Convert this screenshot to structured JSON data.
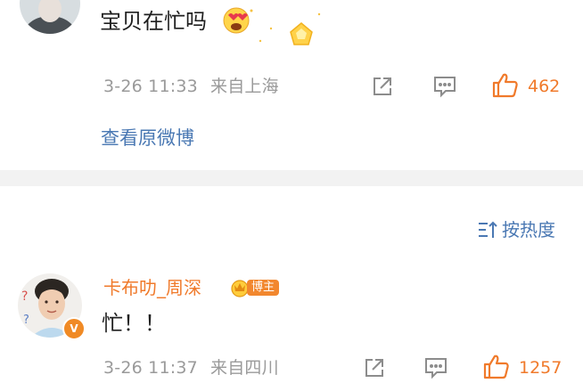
{
  "comment_top": {
    "text": "宝贝在忙吗",
    "time": "3-26 11:33",
    "location": "来自上海",
    "likes": "462"
  },
  "view_original": {
    "label": "查看原微博"
  },
  "sort": {
    "label": "按热度"
  },
  "comment_main": {
    "username": "卡布叻_周深",
    "badge": "博主",
    "text": "忙！！",
    "time": "3-26 11:37",
    "location": "来自四川",
    "likes": "1257",
    "verified": "V"
  },
  "colors": {
    "accent_orange": "#f07a2b",
    "link_blue": "#4a78b3",
    "meta_gray": "#9a9a9a",
    "divider": "#f2f2f2"
  },
  "icons": [
    "share-icon",
    "comment-icon",
    "like-icon",
    "emoji-icon",
    "sort-icon"
  ]
}
